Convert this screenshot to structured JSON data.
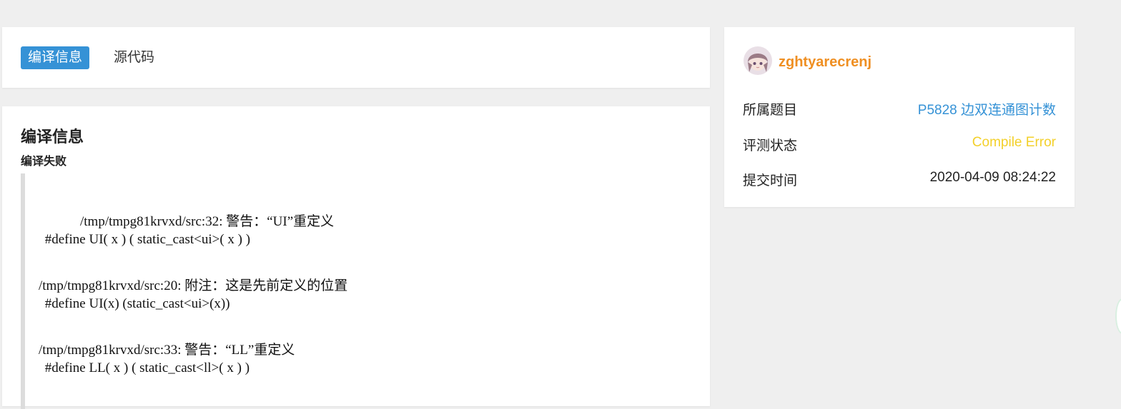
{
  "tabs": [
    {
      "label": "编译信息",
      "active": true
    },
    {
      "label": "源代码",
      "active": false
    }
  ],
  "compile": {
    "title": "编译信息",
    "subtitle": "编译失败",
    "log_lines": [
      "/tmp/tmpg81krvxd/src:32: 警告：“UI”重定义",
      " #define UI( x ) ( static_cast<ui>( x ) )",
      "/tmp/tmpg81krvxd/src:20: 附注：这是先前定义的位置",
      " #define UI(x) (static_cast<ui>(x))",
      "/tmp/tmpg81krvxd/src:33: 警告：“LL”重定义",
      " #define LL( x ) ( static_cast<ll>( x ) )"
    ]
  },
  "sidebar": {
    "username": "zghtyarecrenj",
    "avatar_icon": "anime-girl-avatar",
    "rows": [
      {
        "label": "所属题目",
        "value": "P5828 边双连通图计数"
      },
      {
        "label": "评测状态",
        "value": "Compile Error"
      },
      {
        "label": "提交时间",
        "value": "2020-04-09 08:24:22"
      }
    ]
  },
  "colors": {
    "tab_active_bg": "#3592d6",
    "username": "#ef8f22",
    "link": "#3592d6",
    "status_compile_error": "#f3d02a",
    "page_bg": "#efefef"
  }
}
